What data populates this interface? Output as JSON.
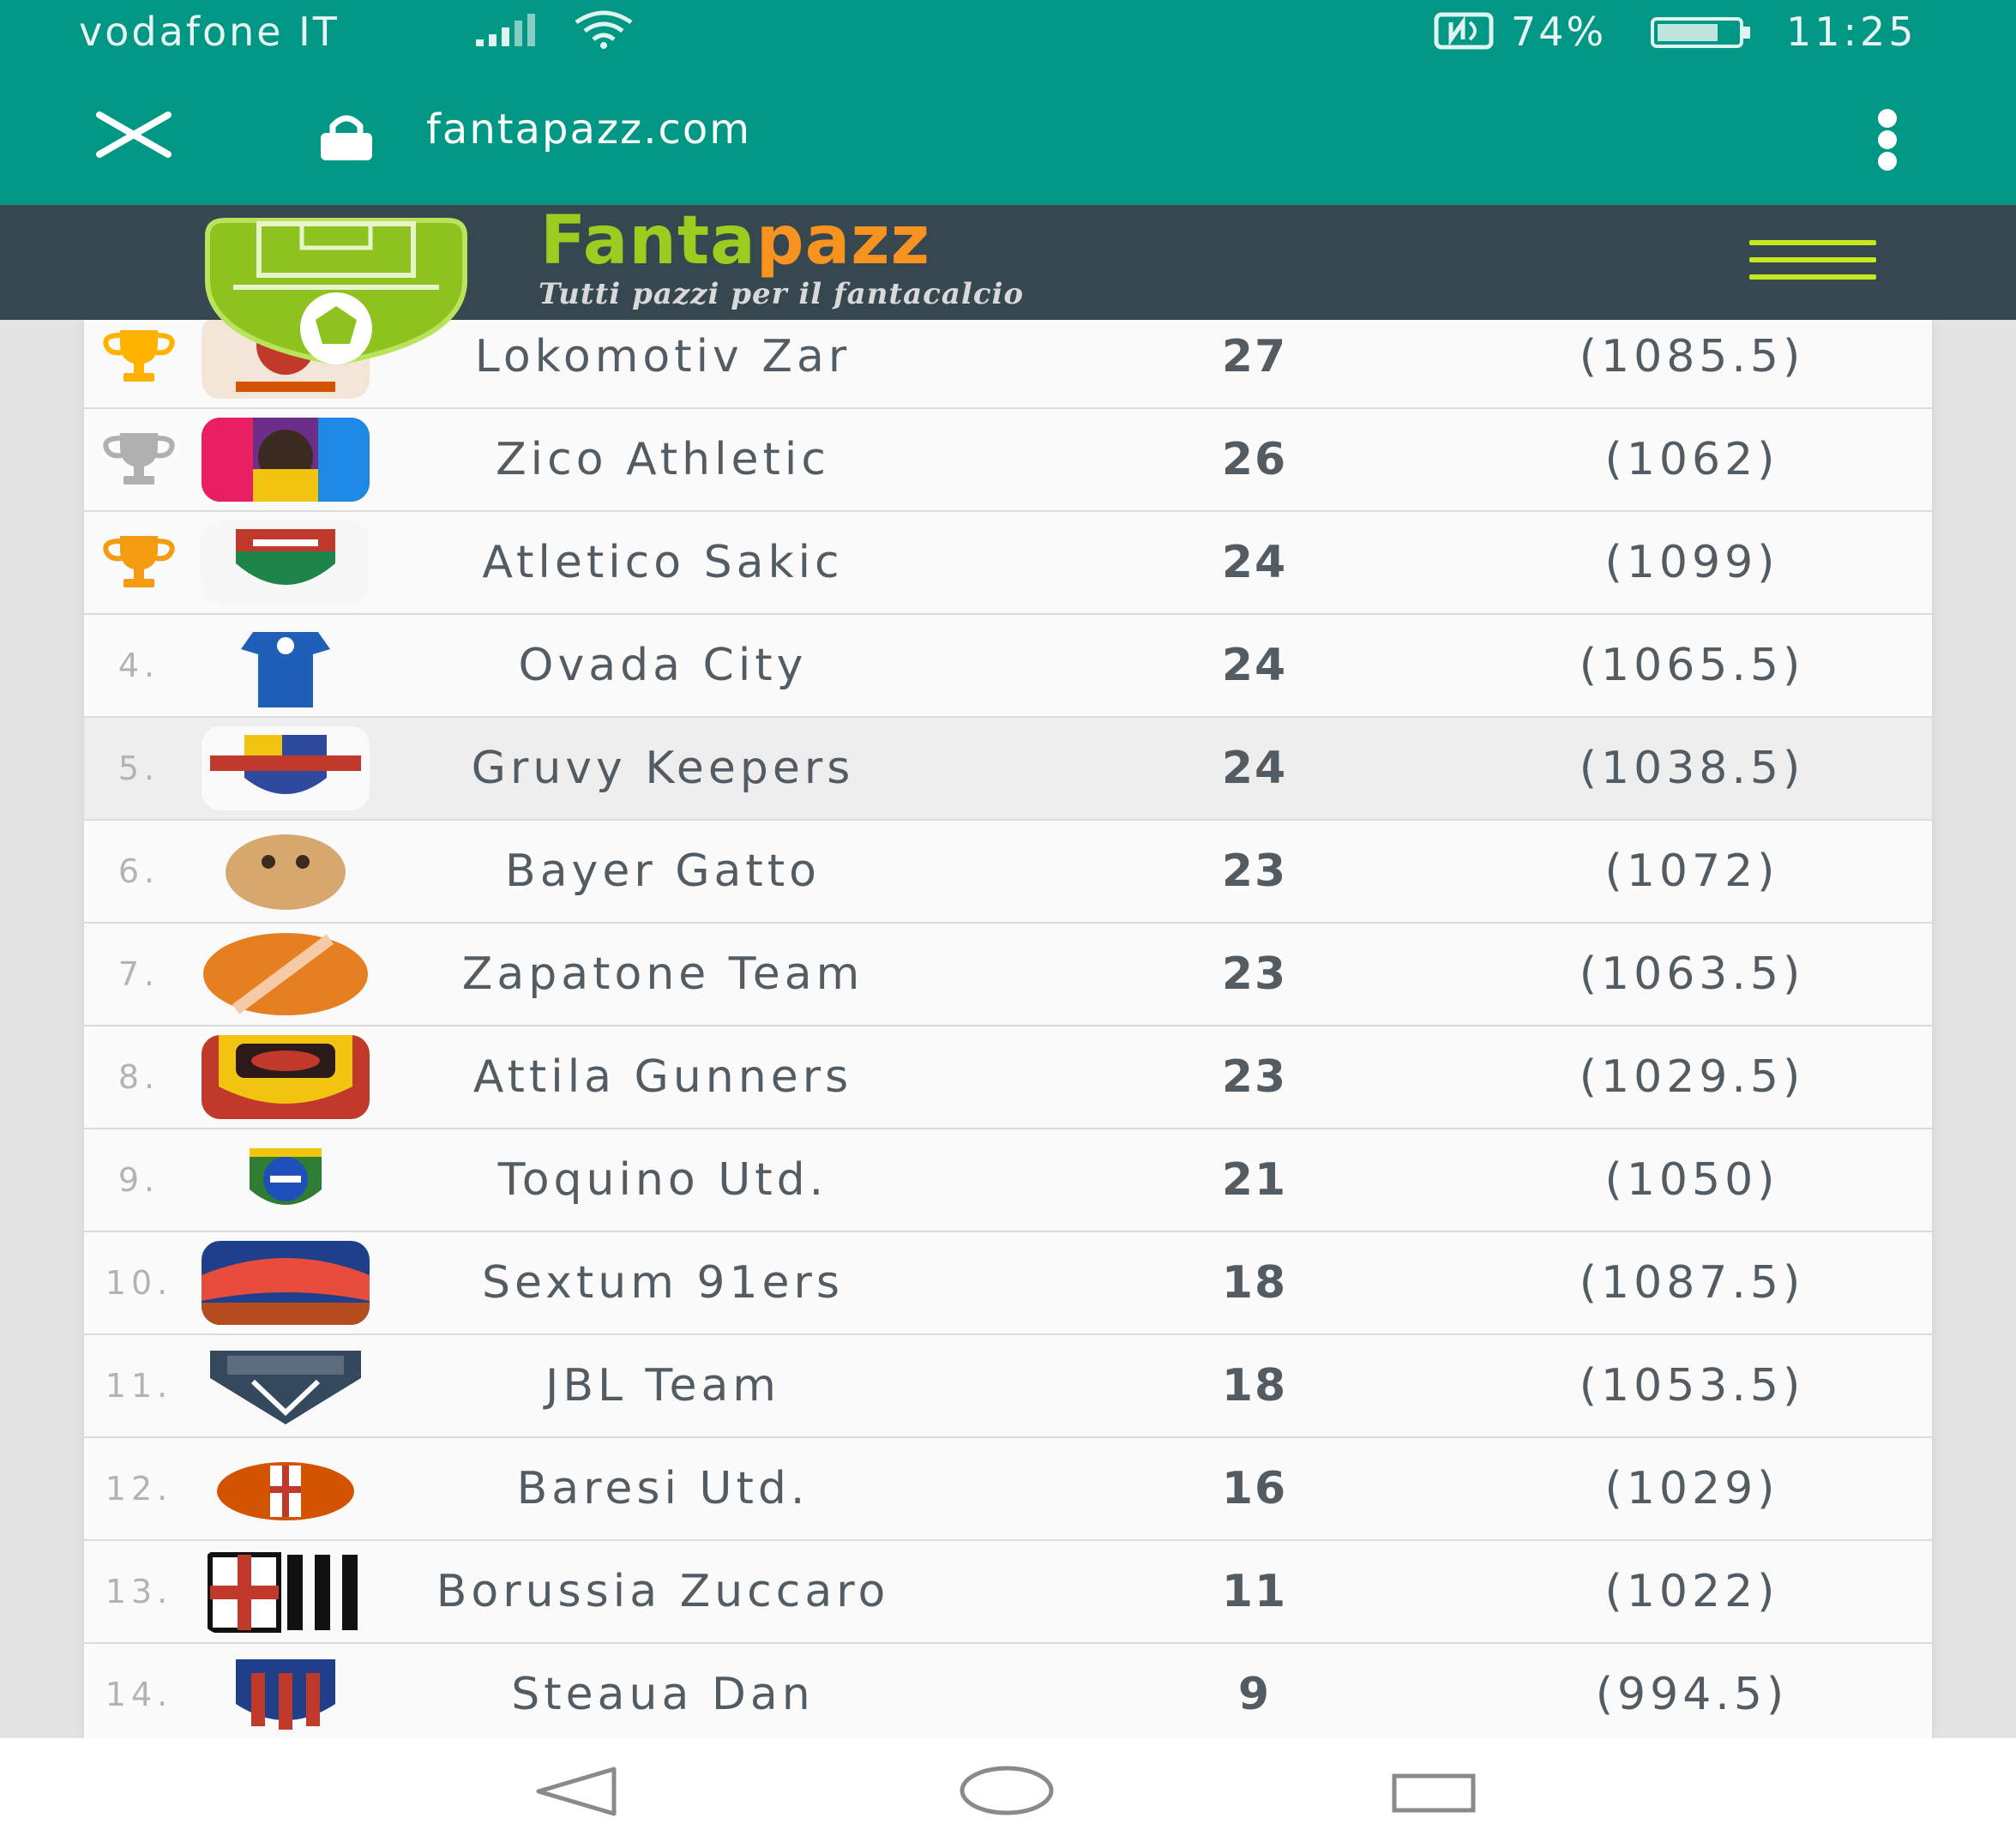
{
  "status_bar": {
    "carrier": "vodafone IT",
    "battery": "74%",
    "time": "11:25"
  },
  "browser": {
    "url": "fantapazz.com"
  },
  "site": {
    "brand_part1": "Fanta",
    "brand_part2": "pazz",
    "tagline": "Tutti pazzi per il fantacalcio"
  },
  "colors": {
    "status_bar": "#009784",
    "site_header": "#37474f",
    "brand_green": "#9ccc1f",
    "brand_orange": "#f7931e",
    "gold": "#ffb300",
    "silver": "#b0b0b0",
    "bronze": "#f39c12"
  },
  "standings": [
    {
      "rank": "",
      "trophy": "gold-trophy-icon",
      "team": "Lokomotiv Zar",
      "points": "27",
      "total": "(1085.5)"
    },
    {
      "rank": "",
      "trophy": "silver-trophy-icon",
      "team": "Zico Athletic",
      "points": "26",
      "total": "(1062)"
    },
    {
      "rank": "",
      "trophy": "bronze-trophy-icon",
      "team": "Atletico Sakic",
      "points": "24",
      "total": "(1099)"
    },
    {
      "rank": "4.",
      "team": "Ovada City",
      "points": "24",
      "total": "(1065.5)"
    },
    {
      "rank": "5.",
      "team": "Gruvy Keepers",
      "points": "24",
      "total": "(1038.5)"
    },
    {
      "rank": "6.",
      "team": "Bayer Gatto",
      "points": "23",
      "total": "(1072)"
    },
    {
      "rank": "7.",
      "team": "Zapatone Team",
      "points": "23",
      "total": "(1063.5)"
    },
    {
      "rank": "8.",
      "team": "Attila Gunners",
      "points": "23",
      "total": "(1029.5)"
    },
    {
      "rank": "9.",
      "team": "Toquino Utd.",
      "points": "21",
      "total": "(1050)"
    },
    {
      "rank": "10.",
      "team": "Sextum 91ers",
      "points": "18",
      "total": "(1087.5)"
    },
    {
      "rank": "11.",
      "team": "JBL Team",
      "points": "18",
      "total": "(1053.5)"
    },
    {
      "rank": "12.",
      "team": "Baresi Utd.",
      "points": "16",
      "total": "(1029)"
    },
    {
      "rank": "13.",
      "team": "Borussia Zuccaro",
      "points": "11",
      "total": "(1022)"
    },
    {
      "rank": "14.",
      "team": "Steaua Dan",
      "points": "9",
      "total": "(994.5)"
    }
  ]
}
